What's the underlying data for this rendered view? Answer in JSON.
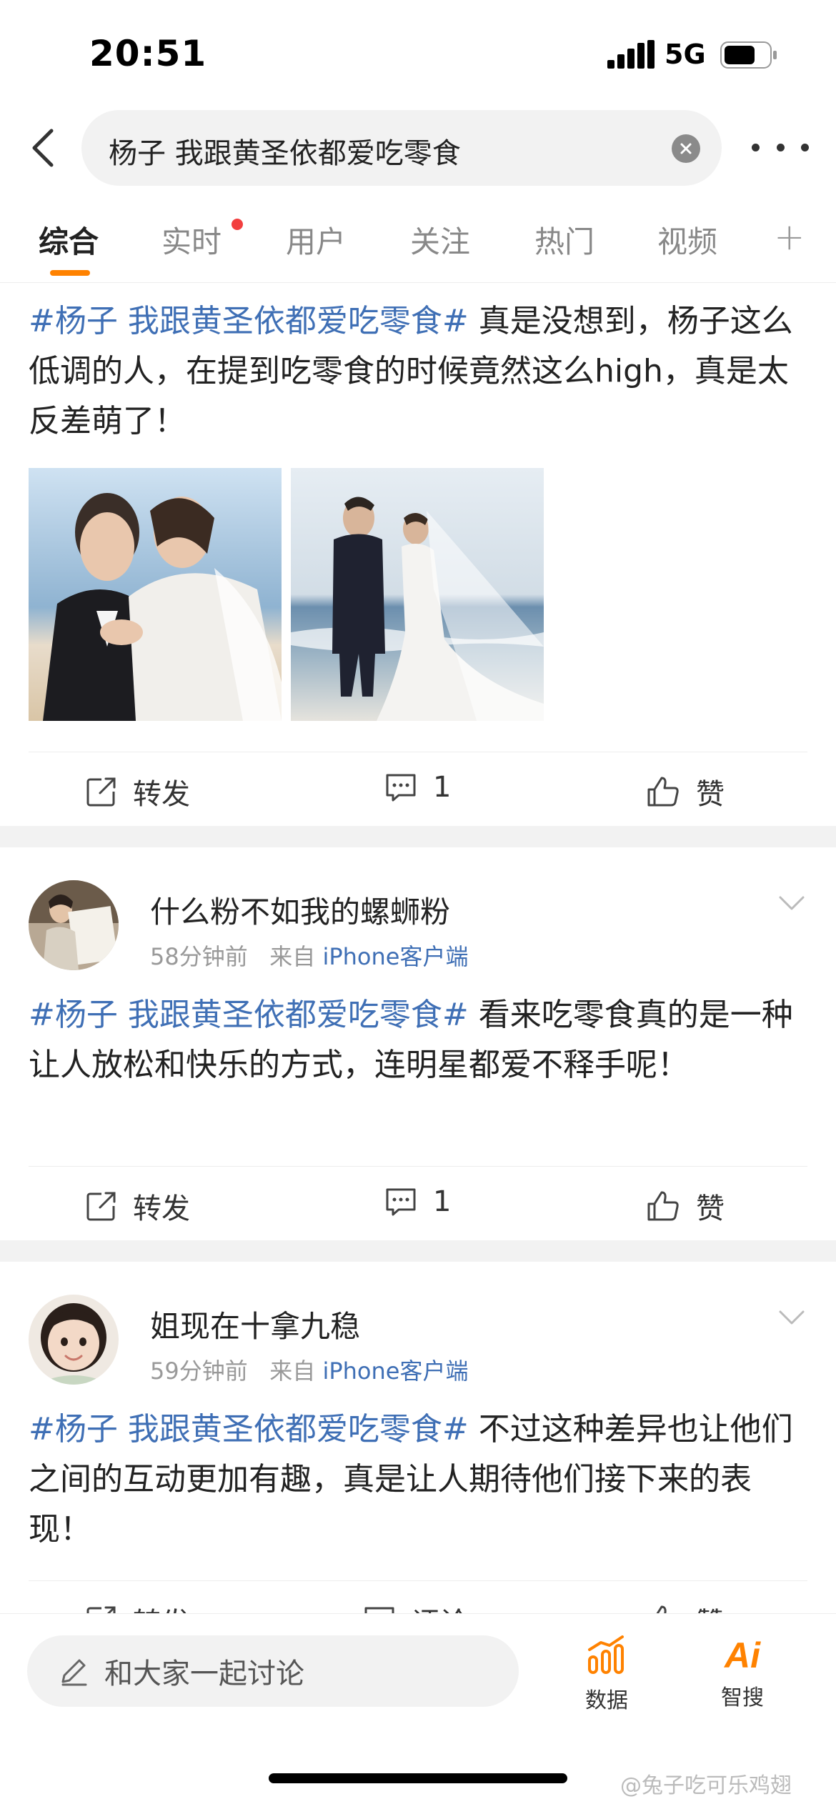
{
  "status_bar": {
    "time": "20:51",
    "network": "5G"
  },
  "search": {
    "query": "杨子 我跟黄圣依都爱吃零食"
  },
  "tabs": [
    {
      "label": "综合",
      "active": true
    },
    {
      "label": "实时",
      "has_dot": true
    },
    {
      "label": "用户"
    },
    {
      "label": "关注"
    },
    {
      "label": "热门"
    },
    {
      "label": "视频"
    }
  ],
  "tab_plus": "+",
  "posts": [
    {
      "hashtag": "#杨子 我跟黄圣依都爱吃零食#",
      "text": " 真是没想到，杨子这么低调的人，在提到吃零食的时候竟然这么high，真是太反差萌了！",
      "images": [
        "wedding-photo-embrace",
        "wedding-photo-beach"
      ],
      "repost_label": "转发",
      "comment_count": "1",
      "like_label": "赞"
    },
    {
      "username": "什么粉不如我的螺蛳粉",
      "time": "58分钟前",
      "source_prefix": "来自",
      "client": "iPhone客户端",
      "hashtag": "#杨子 我跟黄圣依都爱吃零食#",
      "text": " 看来吃零食真的是一种让人放松和快乐的方式，连明星都爱不释手呢！",
      "repost_label": "转发",
      "comment_count": "1",
      "like_label": "赞"
    },
    {
      "username": "姐现在十拿九稳",
      "time": "59分钟前",
      "source_prefix": "来自",
      "client": "iPhone客户端",
      "hashtag": "#杨子 我跟黄圣依都爱吃零食#",
      "text": " 不过这种差异也让他们之间的互动更加有趣，真是让人期待他们接下来的表现！",
      "repost_label": "转发",
      "comment_label": "评论",
      "like_label": "赞"
    }
  ],
  "bottom_bar": {
    "discuss_placeholder": "和大家一起讨论",
    "data_label": "数据",
    "ai_label": "智搜",
    "ai_glyph": "Ai"
  },
  "watermark": "@兔子吃可乐鸡翅",
  "colors": {
    "accent": "#ff8200",
    "link": "#3f6fb5",
    "dot": "#f23f3f"
  }
}
